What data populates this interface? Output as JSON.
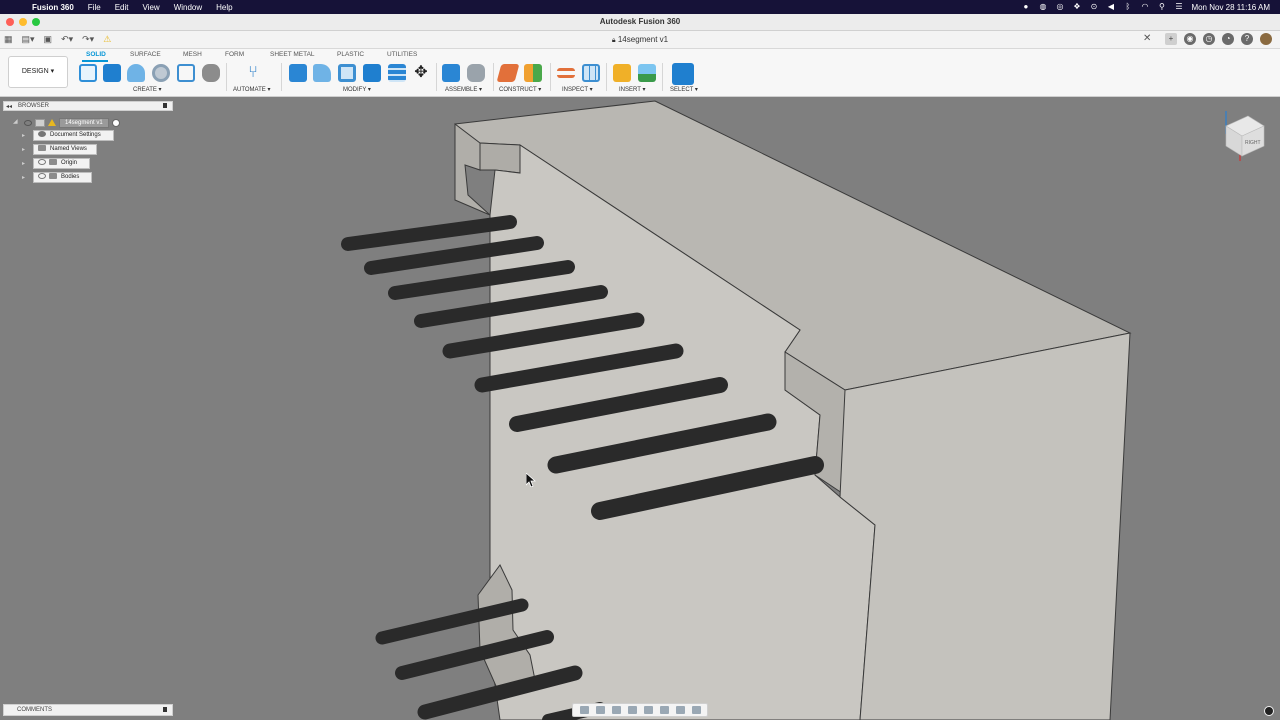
{
  "menubar": {
    "app_name": "Fusion 360",
    "items": [
      "File",
      "Edit",
      "View",
      "Window",
      "Help"
    ],
    "datetime": "Mon Nov 28  11:16 AM"
  },
  "window": {
    "title": "Autodesk Fusion 360"
  },
  "document_tab": {
    "name": "14segment v1"
  },
  "toolbar": {
    "workspace": "DESIGN ▾",
    "tabs": [
      "SOLID",
      "SURFACE",
      "MESH",
      "FORM",
      "SHEET METAL",
      "PLASTIC",
      "UTILITIES"
    ],
    "active_tab": "SOLID",
    "groups": [
      "CREATE ▾",
      "AUTOMATE ▾",
      "MODIFY ▾",
      "ASSEMBLE ▾",
      "CONSTRUCT ▾",
      "INSPECT ▾",
      "INSERT ▾",
      "SELECT ▾"
    ]
  },
  "browser": {
    "title": "BROWSER",
    "root": "14segment v1",
    "items": [
      "Document Settings",
      "Named Views",
      "Origin",
      "Bodies"
    ]
  },
  "comments": {
    "title": "COMMENTS"
  },
  "viewcube": {
    "face_label": "RIGHT"
  },
  "colors": {
    "accent": "#0696d7",
    "menubar_bg": "#161238",
    "viewport_bg": "#7f7f7f",
    "body_face": "#c9c7c2",
    "pin_color": "#222222",
    "warning": "#e8b820"
  }
}
